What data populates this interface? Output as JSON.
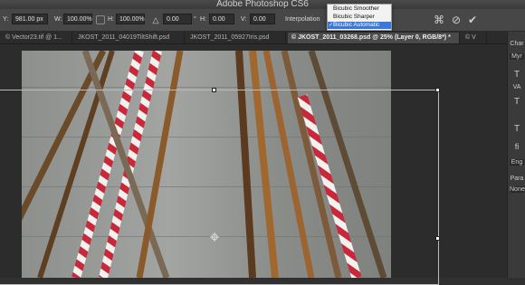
{
  "app_title": "Adobe Photoshop CS6",
  "options": {
    "y_label": "Y:",
    "y_value": "981.00 px",
    "w_label": "W:",
    "w_value": "100.00%",
    "h_label": "H:",
    "h_value": "100.00%",
    "angle_value": "0.00",
    "angle_unit": "°",
    "hskew_label": "H:",
    "hskew_value": "0.00",
    "vskew_label": "V:",
    "vskew_value": "0.00",
    "interpolation_label": "Interpolation"
  },
  "interpolation_menu": {
    "items": [
      "Bicubic Smoother",
      "Bicubic Sharper",
      "Bicubic Automatic"
    ],
    "selected": "Bicubic Automatic",
    "check": "✓"
  },
  "tabs": [
    "© Vector23.tif @ 1...",
    "JKOST_2011_04019TiltShift.psd",
    "JKOST_2011_05927Iris.psd",
    "© JKOST_2011_03268.psd @ 25% (Layer 0, RGB/8*) *",
    "© V"
  ],
  "right_panel": {
    "items": [
      "Char",
      "Myr",
      "T",
      "VA",
      "T",
      "T",
      "fi",
      "Eng",
      "Para",
      "None"
    ]
  },
  "icons": {
    "warp": "warp-icon",
    "cancel": "cancel-icon",
    "commit": "commit-check-icon",
    "angle": "angle-icon",
    "link": "link-icon"
  }
}
